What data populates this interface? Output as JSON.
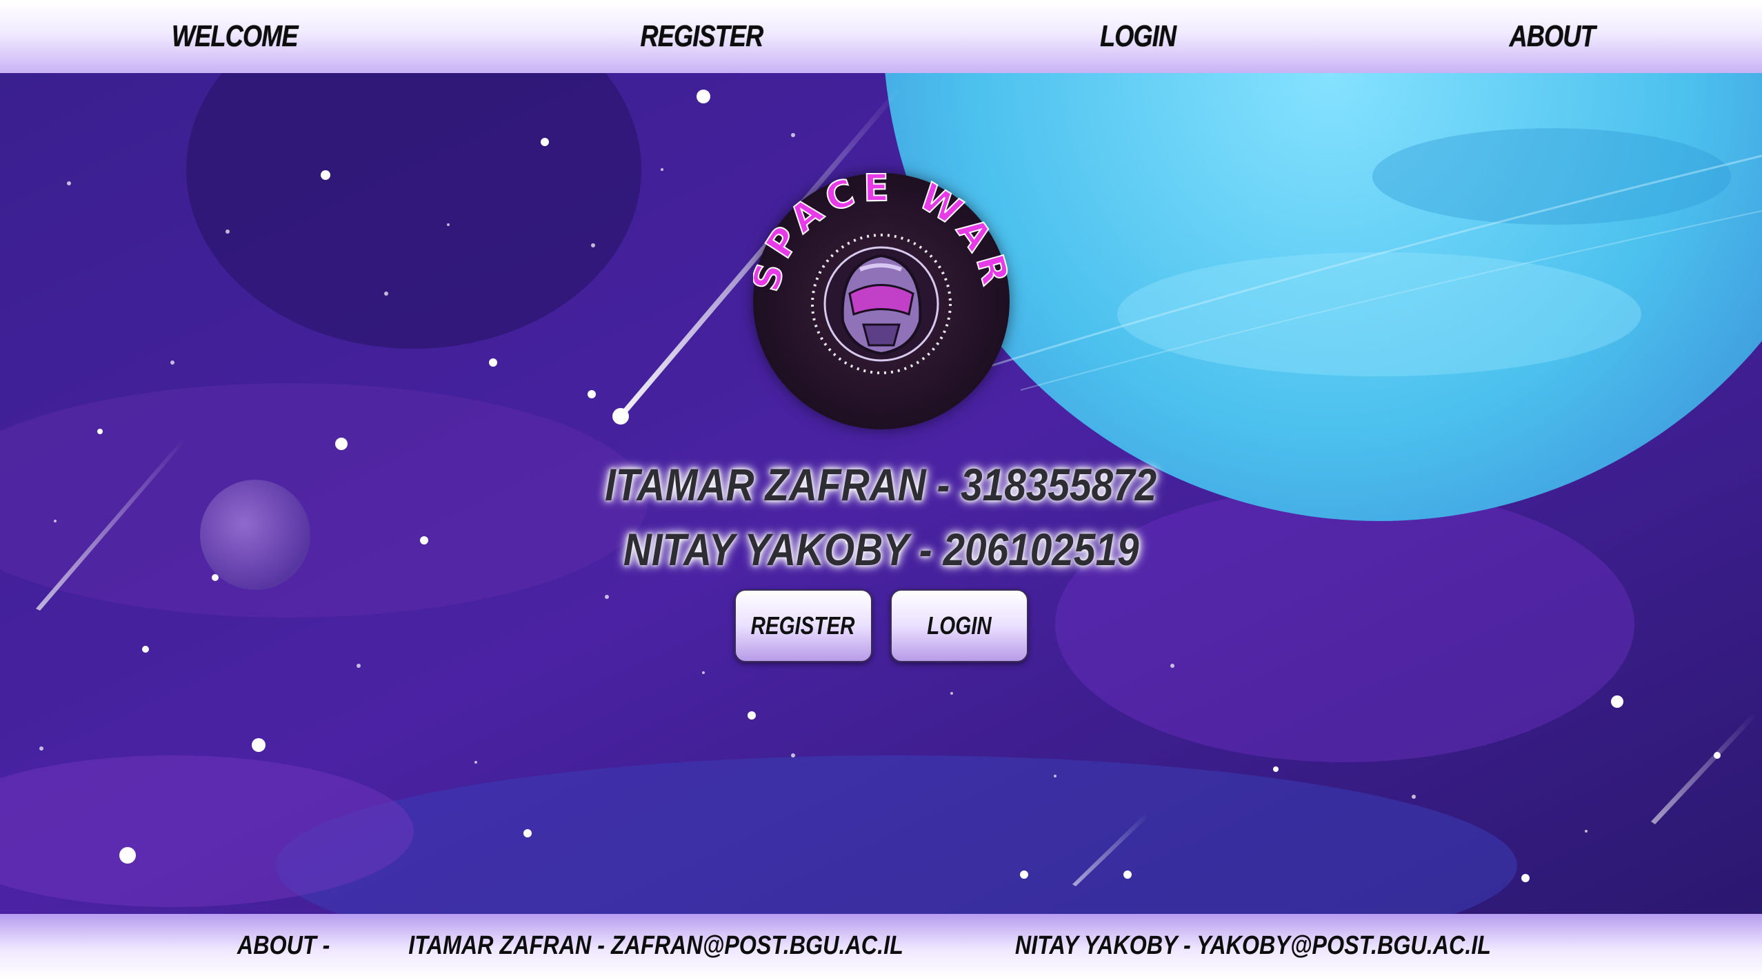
{
  "nav": {
    "welcome": "Welcome",
    "register": "Register",
    "login": "Login",
    "about": "About"
  },
  "logo": {
    "text": "SPACE WAR",
    "icon": "helmet-icon"
  },
  "authors": {
    "line1": "Itamar Zafran - 318355872",
    "line2": "Nitay Yakoby - 206102519"
  },
  "buttons": {
    "register": "Register",
    "login": "Login"
  },
  "footer": {
    "about": "About -",
    "author1": "Itamar Zafran - zafran@post.bgu.ac.il",
    "author2": "Nitay Yakoby - yakoby@post.bgu.ac.il"
  },
  "colors": {
    "nav_bg": "#e9deff",
    "space_bg": "#3b1c86",
    "planet": "#4fc3ee",
    "logo_text": "#e63be6"
  }
}
